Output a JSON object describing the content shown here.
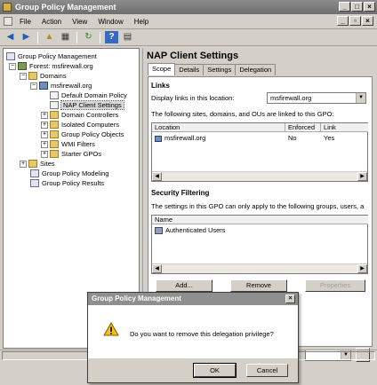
{
  "window": {
    "title": "Group Policy Management"
  },
  "menu": [
    "File",
    "Action",
    "View",
    "Window",
    "Help"
  ],
  "tree": {
    "root": "Group Policy Management",
    "forest": "Forest: msfirewall.org",
    "domains": "Domains",
    "domain": "msfirewall.org",
    "children": [
      "Default Domain Policy",
      "NAP Client Settings",
      "Domain Controllers",
      "Isolated Computers",
      "Group Policy Objects",
      "WMI Filters",
      "Starter GPOs"
    ],
    "selected": "NAP Client Settings",
    "sites": "Sites",
    "modeling": "Group Policy Modeling",
    "results": "Group Policy Results"
  },
  "detail": {
    "title": "NAP Client Settings",
    "tabs": [
      "Scope",
      "Details",
      "Settings",
      "Delegation"
    ],
    "active_tab": "Scope",
    "links": {
      "heading": "Links",
      "display_label": "Display links in this location:",
      "location_value": "msfirewall.org",
      "linked_text": "The following sites, domains, and OUs are linked to this GPO:",
      "columns": [
        "Location",
        "Enforced",
        "Link"
      ],
      "rows": [
        {
          "location": "msfirewall.org",
          "enforced": "No",
          "link": "Yes"
        }
      ]
    },
    "security": {
      "heading": "Security Filtering",
      "text": "The settings in this GPO can only apply to the following groups, users, a",
      "column": "Name",
      "rows": [
        "Authenticated Users"
      ],
      "buttons": {
        "add": "Add...",
        "remove": "Remove",
        "properties": "Properties"
      }
    }
  },
  "dialog": {
    "title": "Group Policy Management",
    "message": "Do you want to remove this delegation privilege?",
    "ok": "OK",
    "cancel": "Cancel"
  }
}
